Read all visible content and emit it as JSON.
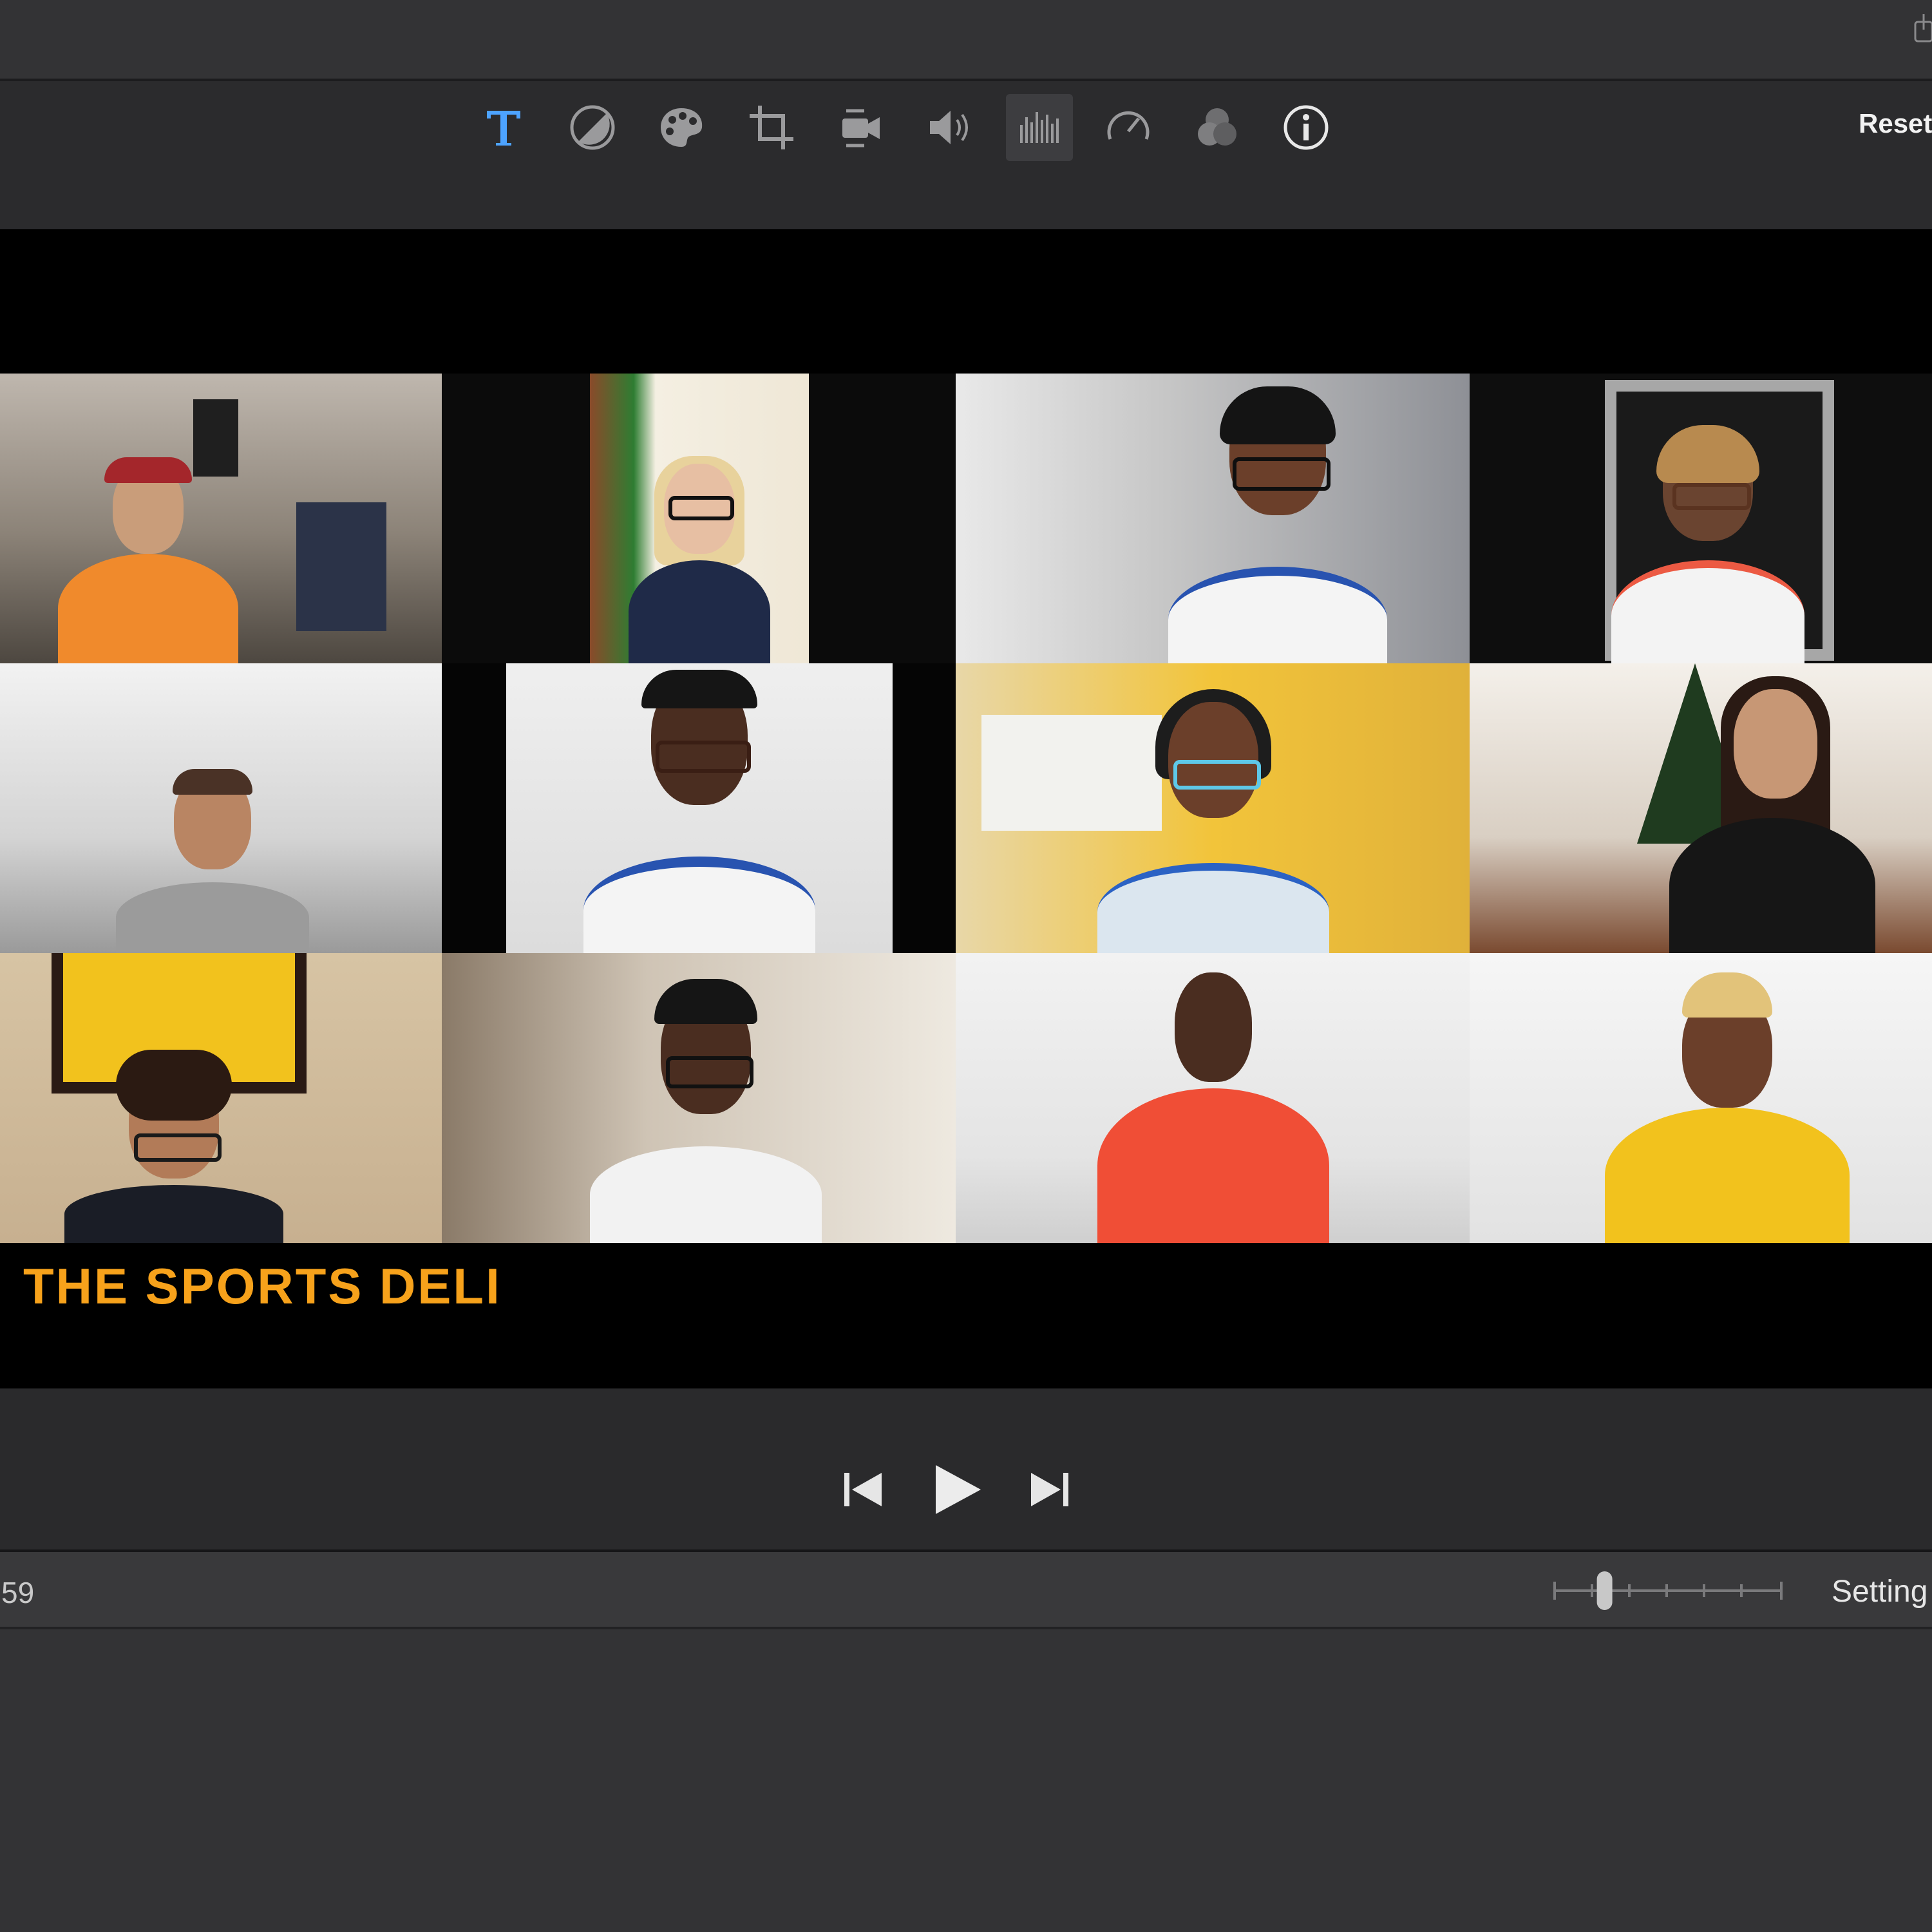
{
  "toolbar": {
    "tools": [
      "title-icon",
      "color-balance-icon",
      "color-correction-icon",
      "crop-icon",
      "stabilization-icon",
      "volume-icon",
      "noise-reduction-icon",
      "speed-icon",
      "clip-filter-icon",
      "info-icon"
    ],
    "active_tool": "noise-reduction-icon",
    "title_color": "#4da3ff",
    "reset_label": "Reset"
  },
  "viewer": {
    "caption": "THE SPORTS DELI",
    "caption_color": "#f7a21b"
  },
  "playback": {
    "controls": [
      "skip-back-icon",
      "play-icon",
      "skip-forward-icon"
    ]
  },
  "timeline": {
    "timecode": "59",
    "settings_label": "Setting",
    "zoom_level": 0.2
  }
}
